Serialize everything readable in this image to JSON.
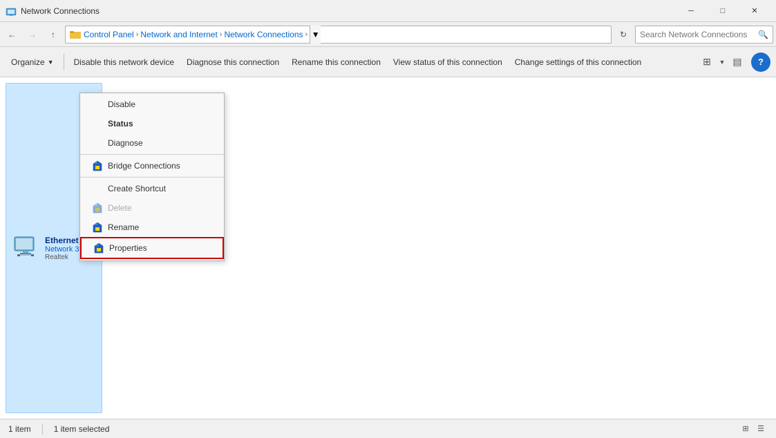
{
  "titleBar": {
    "icon": "network-connections-icon",
    "title": "Network Connections",
    "minimizeLabel": "─",
    "maximizeLabel": "□",
    "closeLabel": "✕"
  },
  "addressBar": {
    "backDisabled": false,
    "forwardDisabled": true,
    "upLabel": "↑",
    "breadcrumb": [
      {
        "label": "Control Panel",
        "sep": "›"
      },
      {
        "label": "Network and Internet",
        "sep": "›"
      },
      {
        "label": "Network Connections",
        "sep": "›"
      }
    ],
    "searchPlaceholder": "Search Network Connections",
    "searchIcon": "🔍"
  },
  "toolbar": {
    "organizeLabel": "Organize",
    "disableLabel": "Disable this network device",
    "diagnoseLabel": "Diagnose this connection",
    "renameLabel": "Rename this connection",
    "viewStatusLabel": "View status of this connection",
    "changeSettingsLabel": "Change settings of this connection"
  },
  "networkItem": {
    "name": "Ethernet",
    "network": "Network 3",
    "adapter": "Realtek"
  },
  "contextMenu": {
    "items": [
      {
        "id": "disable",
        "label": "Disable",
        "icon": "",
        "bold": false,
        "disabled": false,
        "separator": false
      },
      {
        "id": "status",
        "label": "Status",
        "icon": "",
        "bold": true,
        "disabled": false,
        "separator": false
      },
      {
        "id": "diagnose",
        "label": "Diagnose",
        "icon": "",
        "bold": false,
        "disabled": false,
        "separator": false
      },
      {
        "id": "sep1",
        "separator": true
      },
      {
        "id": "bridge",
        "label": "Bridge Connections",
        "icon": "shield",
        "bold": false,
        "disabled": false,
        "separator": false
      },
      {
        "id": "sep2",
        "separator": true
      },
      {
        "id": "shortcut",
        "label": "Create Shortcut",
        "icon": "",
        "bold": false,
        "disabled": false,
        "separator": false
      },
      {
        "id": "delete",
        "label": "Delete",
        "icon": "shield",
        "bold": false,
        "disabled": true,
        "separator": false
      },
      {
        "id": "rename",
        "label": "Rename",
        "icon": "shield",
        "bold": false,
        "disabled": false,
        "separator": false
      },
      {
        "id": "properties",
        "label": "Properties",
        "icon": "shield",
        "bold": false,
        "disabled": false,
        "separator": false,
        "highlighted": true
      }
    ]
  },
  "statusBar": {
    "itemCount": "1 item",
    "selectedCount": "1 item selected"
  }
}
